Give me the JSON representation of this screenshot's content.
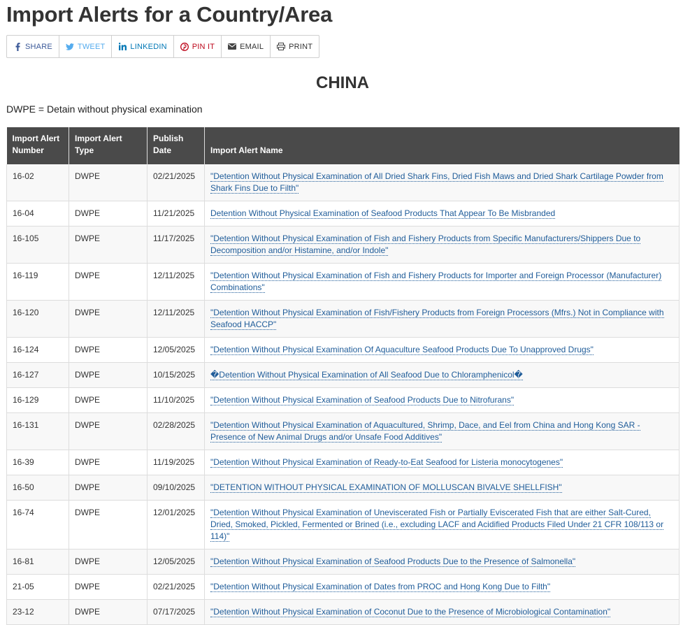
{
  "page": {
    "title": "Import Alerts for a Country/Area",
    "country": "CHINA",
    "legend": "DWPE = Detain without physical examination"
  },
  "share": [
    {
      "label": "SHARE",
      "icon": "facebook-icon"
    },
    {
      "label": "TWEET",
      "icon": "twitter-icon"
    },
    {
      "label": "LINKEDIN",
      "icon": "linkedin-icon"
    },
    {
      "label": "PIN IT",
      "icon": "pinterest-icon"
    },
    {
      "label": "EMAIL",
      "icon": "email-icon"
    },
    {
      "label": "PRINT",
      "icon": "print-icon"
    }
  ],
  "table": {
    "headers": [
      "Import Alert Number",
      "Import Alert Type",
      "Publish Date",
      "Import Alert Name"
    ],
    "rows": [
      {
        "number": "16-02",
        "type": "DWPE",
        "date": "02/21/2025",
        "name": "\"Detention Without Physical Examination of All Dried Shark Fins, Dried Fish Maws and Dried Shark Cartilage Powder from Shark Fins Due to Filth\""
      },
      {
        "number": "16-04",
        "type": "DWPE",
        "date": "11/21/2025",
        "name": "Detention Without Physical Examination of Seafood Products That Appear To Be Misbranded"
      },
      {
        "number": "16-105",
        "type": "DWPE",
        "date": "11/17/2025",
        "name": "\"Detention Without Physical Examination of Fish and Fishery Products from Specific Manufacturers/Shippers Due to Decomposition and/or Histamine, and/or Indole\""
      },
      {
        "number": "16-119",
        "type": "DWPE",
        "date": "12/11/2025",
        "name": "\"Detention Without Physical Examination of Fish and Fishery Products for Importer and Foreign Processor (Manufacturer) Combinations\""
      },
      {
        "number": "16-120",
        "type": "DWPE",
        "date": "12/11/2025",
        "name": "\"Detention Without Physical Examination of Fish/Fishery Products from Foreign Processors (Mfrs.) Not in Compliance with Seafood HACCP\""
      },
      {
        "number": "16-124",
        "type": "DWPE",
        "date": "12/05/2025",
        "name": "\"Detention Without Physical Examination Of Aquaculture Seafood Products Due To Unapproved Drugs\""
      },
      {
        "number": "16-127",
        "type": "DWPE",
        "date": "10/15/2025",
        "name": "�Detention Without Physical Examination of All Seafood Due to Chloramphenicol�"
      },
      {
        "number": "16-129",
        "type": "DWPE",
        "date": "11/10/2025",
        "name": "\"Detention Without Physical Examination of Seafood Products Due to Nitrofurans\""
      },
      {
        "number": "16-131",
        "type": "DWPE",
        "date": "02/28/2025",
        "name": "\"Detention Without Physical Examination of Aquacultured, Shrimp, Dace, and Eel from China and Hong Kong SAR - Presence of New Animal Drugs and/or Unsafe Food Additives\""
      },
      {
        "number": "16-39",
        "type": "DWPE",
        "date": "11/19/2025",
        "name": "\"Detention Without Physical Examination of Ready-to-Eat Seafood for Listeria monocytogenes\""
      },
      {
        "number": "16-50",
        "type": "DWPE",
        "date": "09/10/2025",
        "name": "\"DETENTION WITHOUT PHYSICAL EXAMINATION OF MOLLUSCAN BIVALVE SHELLFISH\""
      },
      {
        "number": "16-74",
        "type": "DWPE",
        "date": "12/01/2025",
        "name": "\"Detention Without Physical Examination of Uneviscerated Fish or Partially Eviscerated Fish that are either Salt-Cured, Dried, Smoked, Pickled, Fermented or Brined (i.e., excluding LACF and Acidified Products Filed Under 21 CFR 108/113 or 114)\""
      },
      {
        "number": "16-81",
        "type": "DWPE",
        "date": "12/05/2025",
        "name": "\"Detention Without Physical Examination of Seafood Products Due to the Presence of Salmonella\""
      },
      {
        "number": "21-05",
        "type": "DWPE",
        "date": "02/21/2025",
        "name": "\"Detention Without Physical Examination of Dates from PROC and Hong Kong Due to Filth\""
      },
      {
        "number": "23-12",
        "type": "DWPE",
        "date": "07/17/2025",
        "name": "\"Detention Without Physical Examination of Coconut Due to the Presence of Microbiological Contamination\""
      }
    ]
  }
}
